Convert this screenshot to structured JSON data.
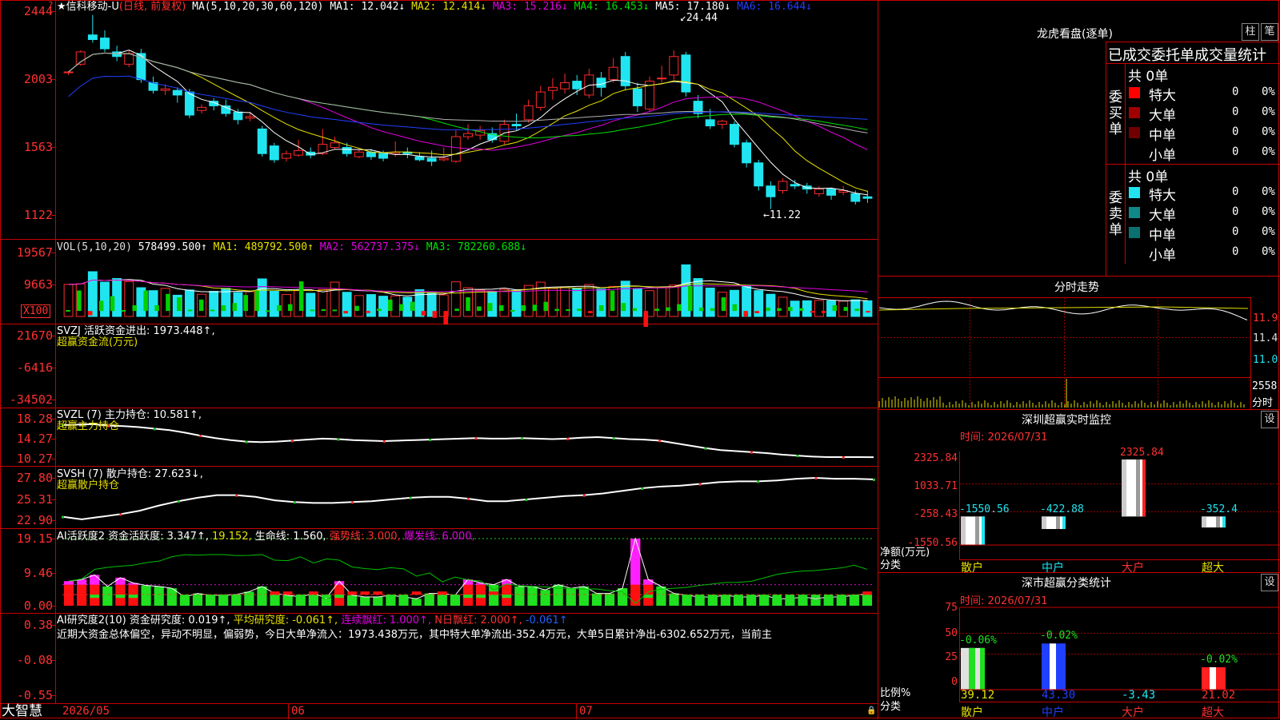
{
  "app": {
    "brand": "大智慧",
    "stock_title": "信科移动-U",
    "period": "(日线, 前复权)",
    "star": "★",
    "red_corner": "?"
  },
  "colors": {
    "up": "#ff2a2a",
    "down": "#20e5f0",
    "ma1": "#ffffff",
    "ma2": "#e6e000",
    "ma3": "#e000e0",
    "ma4": "#00e000",
    "ma5": "#b0b0b0",
    "ma6": "#2040ff",
    "bg": "#000000",
    "grid": "#c80000"
  },
  "header": {
    "ma_label": "MA(5,10,20,30,60,120)",
    "items": [
      {
        "text": "MA1: 12.042↓",
        "color": "#ffffff"
      },
      {
        "text": "MA2: 12.414↓",
        "color": "#e6e000"
      },
      {
        "text": "MA3: 15.216↓",
        "color": "#e000e0"
      },
      {
        "text": "MA4: 16.453↓",
        "color": "#00e000"
      },
      {
        "text": "MA5: 17.180↓",
        "color": "#ffffff"
      },
      {
        "text": "MA6: 16.644↓",
        "color": "#2040ff"
      }
    ]
  },
  "price_axis": [
    "2444",
    "2003",
    "1563",
    "1122"
  ],
  "price_annotations": {
    "high": "24.44",
    "low": "←11.22"
  },
  "vol_panel": {
    "header": "VOL(5,10,20)",
    "value": "578499.500↑",
    "ma1": "MA1: 489792.500↑",
    "ma2": "MA2: 562737.375↓",
    "ma3": "MA3: 782260.688↓",
    "axis": [
      "19567",
      "9663"
    ],
    "unit": "X100"
  },
  "svzj_panel": {
    "header": "SVZJ  活跃资金进出: 1973.448↑,",
    "subtitle": "超赢资金流(万元)",
    "axis": [
      "21670",
      "-6416",
      "-34502"
    ]
  },
  "svzl_panel": {
    "header": "SVZL (7) 主力持仓: 10.581↑,",
    "subtitle": "超赢主力持仓",
    "axis": [
      "18.28",
      "14.27",
      "10.27"
    ]
  },
  "svsh_panel": {
    "header": "SVSH (7) 散户持仓: 27.623↓,",
    "subtitle": "超赢散户持仓",
    "axis": [
      "27.80",
      "25.31",
      "22.90"
    ]
  },
  "ai_active_panel": {
    "header": "AI活跃度2 资金活跃度: 3.347↑,",
    "v2": "19.152,",
    "life": "生命线: 1.560,",
    "strong": "强势线: 3.000,",
    "burst": "爆发线: 6.000,",
    "axis": [
      "19.15",
      "9.46",
      "0.00"
    ]
  },
  "ai_research_panel": {
    "header": "AI研究度2(10) 资金研究度: 0.019↑,",
    "avg": "平均研究度: -0.061↑,",
    "cont": "连续飘红: 1.000↑,",
    "nday": "N日飘红: 2.000↑,",
    "last": "-0.061↑",
    "commentary": "近期大资金总体偏空，异动不明显，偏弱势，今日大单净流入：1973.438万元，其中特大单净流出-352.4万元，大单5日累计净出-6302.652万元，当前主",
    "axis": [
      "0.38",
      "-0.08",
      "-0.55"
    ]
  },
  "date_axis": [
    "2026/05",
    "06",
    "07"
  ],
  "lhb": {
    "title": "龙虎看盘(逐单)",
    "btn1": "柱",
    "btn2": "笔",
    "subtitle": "已成交委托单成交量统计",
    "buy": {
      "side": "委买单",
      "total": "共 0单",
      "rows": [
        {
          "label": "特大",
          "value": "0",
          "pct": "0%",
          "color": "#ff0000"
        },
        {
          "label": "大单",
          "value": "0",
          "pct": "0%",
          "color": "#a00000"
        },
        {
          "label": "中单",
          "value": "0",
          "pct": "0%",
          "color": "#700000"
        },
        {
          "label": "小单",
          "value": "0",
          "pct": "0%",
          "color": ""
        }
      ]
    },
    "sell": {
      "side": "委卖单",
      "total": "共 0单",
      "rows": [
        {
          "label": "特大",
          "value": "0",
          "pct": "0%",
          "color": "#20e5f0"
        },
        {
          "label": "大单",
          "value": "0",
          "pct": "0%",
          "color": "#108888"
        },
        {
          "label": "中单",
          "value": "0",
          "pct": "0%",
          "color": "#0a7070"
        },
        {
          "label": "小单",
          "value": "0",
          "pct": "0%",
          "color": ""
        }
      ]
    }
  },
  "intraday": {
    "title": "分时走势",
    "axis": [
      "11.9",
      "11.4",
      "11.0"
    ],
    "vol_axis": "2558",
    "vol_label": "分时"
  },
  "sz_monitor": {
    "title": "深圳超赢实时监控",
    "time": "时间: 2026/07/31",
    "settings": "设",
    "axis": [
      "2325.84",
      "1033.71",
      "-258.43",
      "-1550.56"
    ],
    "ylabel": "净额(万元)",
    "xlabel": "分类",
    "categories": [
      "散户",
      "中户",
      "大户",
      "超大"
    ],
    "labels": [
      "-1550.56",
      "-422.88",
      "2325.84",
      "-352.4"
    ]
  },
  "sz_class": {
    "title": "深市超赢分类统计",
    "time": "时间: 2026/07/31",
    "settings": "设",
    "axis": [
      "75",
      "50",
      "25",
      "0"
    ],
    "ylabel": "比例%",
    "xlabel": "分类",
    "categories": [
      "散户",
      "中户",
      "大户",
      "超大"
    ],
    "top_labels": [
      "-0.06%",
      "-0.02%",
      "",
      "-0.02%"
    ],
    "bottom_labels": [
      "39.12",
      "43.30",
      "-3.43",
      "21.02"
    ]
  },
  "chart_data": [
    {
      "type": "candlestick",
      "title": "信科移动-U",
      "ylim": [
        11.22,
        24.44
      ],
      "price_high": 24.44,
      "price_low": 11.22,
      "candles": [
        [
          20.5,
          20.5,
          20.5,
          20.3
        ],
        [
          21.0,
          21.8,
          21.9,
          20.9
        ],
        [
          22.9,
          22.6,
          24.2,
          22.4
        ],
        [
          22.7,
          22.0,
          23.2,
          21.8
        ],
        [
          21.8,
          21.5,
          22.2,
          21.2
        ],
        [
          21.0,
          21.7,
          21.9,
          20.8
        ],
        [
          21.7,
          20.0,
          22.0,
          19.8
        ],
        [
          19.8,
          19.3,
          20.2,
          19.1
        ],
        [
          19.3,
          19.4,
          19.7,
          19.0
        ],
        [
          19.3,
          19.0,
          19.5,
          18.5
        ],
        [
          19.2,
          17.7,
          19.4,
          17.5
        ],
        [
          18.0,
          18.2,
          18.4,
          17.8
        ],
        [
          18.6,
          18.3,
          18.8,
          18.0
        ],
        [
          18.3,
          17.8,
          18.7,
          17.6
        ],
        [
          17.9,
          17.4,
          18.1,
          17.1
        ],
        [
          17.5,
          17.6,
          17.9,
          17.3
        ],
        [
          16.8,
          15.2,
          17.0,
          15.0
        ],
        [
          15.7,
          14.8,
          15.9,
          14.6
        ],
        [
          14.9,
          15.2,
          15.4,
          14.7
        ],
        [
          15.1,
          15.4,
          16.1,
          15.0
        ],
        [
          15.3,
          15.1,
          15.6,
          14.9
        ],
        [
          15.2,
          15.8,
          16.8,
          15.1
        ],
        [
          15.6,
          15.9,
          16.3,
          15.5
        ],
        [
          15.6,
          15.2,
          15.9,
          15.0
        ],
        [
          15.0,
          15.3,
          15.5,
          14.9
        ],
        [
          15.3,
          15.0,
          15.5,
          14.8
        ],
        [
          15.2,
          14.9,
          15.4,
          14.7
        ],
        [
          15.2,
          15.3,
          16.0,
          15.0
        ],
        [
          15.3,
          15.2,
          15.6,
          14.9
        ],
        [
          15.0,
          14.8,
          15.3,
          14.7
        ],
        [
          14.9,
          14.7,
          15.4,
          14.4
        ],
        [
          14.8,
          14.9,
          15.6,
          14.7
        ],
        [
          14.7,
          16.3,
          16.7,
          14.6
        ],
        [
          16.3,
          16.5,
          17.1,
          16.1
        ],
        [
          16.4,
          16.7,
          17.0,
          16.1
        ],
        [
          16.5,
          16.1,
          16.9,
          15.9
        ],
        [
          16.0,
          17.1,
          17.4,
          15.8
        ],
        [
          17.1,
          17.0,
          17.8,
          16.7
        ],
        [
          17.4,
          18.3,
          18.7,
          17.2
        ],
        [
          18.2,
          19.2,
          19.6,
          18.0
        ],
        [
          19.3,
          19.5,
          20.1,
          18.7
        ],
        [
          19.4,
          19.8,
          20.4,
          19.1
        ],
        [
          19.9,
          19.4,
          20.3,
          19.0
        ],
        [
          19.0,
          20.3,
          20.7,
          18.8
        ],
        [
          20.1,
          19.5,
          20.5,
          18.9
        ],
        [
          20.0,
          20.8,
          21.4,
          19.8
        ],
        [
          21.5,
          19.6,
          21.8,
          19.3
        ],
        [
          19.4,
          18.3,
          19.8,
          17.9
        ],
        [
          18.1,
          19.9,
          20.2,
          17.9
        ],
        [
          20.1,
          20.1,
          20.9,
          19.8
        ],
        [
          20.3,
          21.5,
          21.9,
          20.0
        ],
        [
          21.6,
          19.2,
          21.8,
          18.9
        ],
        [
          18.6,
          17.8,
          19.0,
          17.5
        ],
        [
          17.4,
          17.0,
          18.1,
          16.8
        ],
        [
          17.1,
          17.3,
          17.4,
          16.8
        ],
        [
          17.1,
          15.8,
          17.3,
          15.6
        ],
        [
          15.9,
          14.6,
          16.1,
          14.3
        ],
        [
          14.6,
          13.1,
          14.8,
          12.8
        ],
        [
          13.1,
          12.4,
          13.4,
          11.6
        ],
        [
          12.8,
          13.4,
          13.6,
          12.6
        ],
        [
          13.2,
          13.1,
          13.5,
          12.9
        ],
        [
          13.1,
          12.9,
          13.3,
          12.6
        ],
        [
          12.6,
          12.9,
          13.1,
          12.4
        ],
        [
          12.9,
          12.5,
          13.0,
          12.2
        ],
        [
          12.7,
          12.8,
          13.1,
          12.5
        ],
        [
          12.6,
          12.1,
          12.8,
          11.9
        ],
        [
          12.4,
          12.3,
          12.8,
          12.0
        ]
      ]
    },
    {
      "type": "bar",
      "title": "VOL(5,10,20)",
      "ylim": [
        0,
        19567
      ],
      "values": [
        9800,
        10000,
        13700,
        10500,
        11600,
        10700,
        8800,
        7900,
        8600,
        6500,
        8100,
        6800,
        7700,
        8600,
        7300,
        7600,
        11500,
        7700,
        6700,
        7900,
        7100,
        8200,
        10500,
        7400,
        6400,
        6700,
        6200,
        6300,
        5900,
        8200,
        7300,
        6600,
        10600,
        8800,
        8100,
        7600,
        8300,
        8000,
        9500,
        10500,
        8600,
        8800,
        8600,
        9800,
        8400,
        9200,
        10800,
        8500,
        7900,
        8900,
        9600,
        15800,
        11600,
        8700,
        7400,
        8000,
        9400,
        7900,
        6800,
        5900,
        4700,
        4800,
        4900,
        4800,
        4700,
        5100,
        4800
      ]
    },
    {
      "type": "bar",
      "title": "超赢资金流(万元)",
      "ylim": [
        -34502,
        21670
      ],
      "values": [
        -800,
        -18000,
        3800,
        -9000,
        -13000,
        -800,
        -5000,
        -18000,
        -5000,
        -15000,
        -12000,
        -1200,
        -10000,
        -1200,
        -5000,
        -7000,
        -14000,
        -18000,
        -600,
        -5000,
        -6000,
        -26000,
        -1200,
        -1500,
        -1200,
        2200,
        -4500,
        1800,
        -2000,
        -10000,
        -6000,
        -8000,
        4000,
        6000,
        12000,
        -2000,
        -12000,
        -4000,
        -7000,
        -5000,
        -800,
        -5000,
        -5500,
        -8000,
        -1800,
        -1500,
        -2000,
        2000,
        -5000,
        -18000,
        -7000,
        -2500,
        14000,
        -2000,
        -3200,
        -6000,
        -22000,
        -3000,
        -2500,
        -12000,
        -6000,
        5000,
        2000,
        -3000,
        -2500,
        -3500,
        -2500,
        1500,
        1800,
        -5000,
        -3500,
        -2000,
        1300
      ]
    },
    {
      "type": "line",
      "title": "超赢主力持仓",
      "ylim": [
        10.27,
        18.28
      ],
      "values": [
        17.0,
        17.1,
        17.2,
        16.9,
        16.8,
        16.6,
        16.3,
        16.0,
        15.5,
        14.9,
        14.4,
        14.0,
        13.7,
        13.6,
        13.7,
        13.9,
        14.1,
        14.3,
        14.2,
        14.0,
        13.9,
        13.8,
        13.9,
        14.0,
        14.1,
        14.2,
        14.3,
        14.4,
        14.3,
        14.3,
        14.4,
        14.3,
        14.2,
        14.3,
        14.5,
        14.6,
        14.4,
        14.2,
        14.1,
        13.9,
        13.4,
        12.9,
        12.4,
        12.0,
        11.8,
        11.6,
        11.4,
        11.1,
        10.9,
        10.7,
        10.6,
        10.6,
        10.6,
        10.58
      ]
    },
    {
      "type": "line",
      "title": "超赢散户持仓",
      "ylim": [
        22.9,
        27.8
      ],
      "values": [
        23.3,
        23.0,
        23.3,
        23.6,
        24.0,
        24.6,
        25.1,
        25.5,
        25.8,
        25.8,
        25.6,
        25.2,
        25.0,
        24.9,
        24.9,
        25.0,
        25.1,
        25.3,
        25.5,
        25.6,
        25.6,
        25.4,
        25.1,
        25.1,
        25.3,
        25.5,
        25.7,
        25.8,
        26.0,
        26.3,
        26.6,
        26.8,
        26.9,
        27.1,
        27.3,
        27.4,
        27.4,
        27.5,
        27.7,
        27.8,
        27.7,
        27.7,
        27.623
      ]
    },
    {
      "type": "bar",
      "title": "AI活跃度2",
      "ylim": [
        0,
        19.15
      ],
      "reference_lines": {
        "strong": 3.0,
        "burst": 6.0,
        "top": 19.15
      },
      "values": [
        7.0,
        7.5,
        8.8,
        5.5,
        8.0,
        6.5,
        5.8,
        5.5,
        5.0,
        2.5,
        3.5,
        3.0,
        3.0,
        3.2,
        4.0,
        5.5,
        3.5,
        3.0,
        2.5,
        3.5,
        2.2,
        7.0,
        3.0,
        2.5,
        2.5,
        3.0,
        2.5,
        2.0,
        3.5,
        3.5,
        3.0,
        7.5,
        6.5,
        6.0,
        7.5,
        5.5,
        5.5,
        4.5,
        6.0,
        5.0,
        5.5,
        3.5,
        3.5,
        5.0,
        19.15,
        7.5,
        5.5,
        3.5,
        3.0,
        2.5,
        2.5,
        3.0,
        2.5,
        2.5,
        3.0,
        2.0,
        2.0,
        2.5,
        2.0,
        2.5,
        2.5,
        3.0,
        3.347
      ]
    },
    {
      "type": "bar",
      "title": "AI研究度2(10)",
      "ylim": [
        -0.55,
        0.38
      ],
      "values": [
        0.05,
        0.05,
        -0.05,
        -0.05,
        -0.04,
        -0.03,
        -0.04,
        -0.04,
        -0.08,
        -0.09,
        -0.07,
        -0.08,
        -0.09,
        -0.04,
        -0.04,
        -0.05,
        0.02,
        0.02,
        -0.04,
        0.03,
        -0.04,
        -0.04,
        0.03,
        0.03,
        0.02,
        -0.03,
        -0.04,
        0.03,
        -0.04,
        0.05,
        -0.04,
        -0.03,
        -0.04,
        0.05,
        -0.05,
        -0.05,
        -0.06,
        -0.07,
        -0.07,
        -0.08,
        -0.08,
        -0.09,
        -0.07,
        -0.06,
        0.1,
        -0.05,
        -0.08,
        -0.08,
        -0.08,
        -0.09,
        -0.09,
        -0.09,
        -0.07,
        -0.06,
        -0.08,
        -0.1,
        -0.1,
        -0.09,
        -0.07,
        -0.06,
        -0.05,
        -0.06,
        0.019
      ]
    },
    {
      "type": "bar",
      "title": "深圳超赢实时监控",
      "categories": [
        "散户",
        "中户",
        "大户",
        "超大"
      ],
      "values": [
        -1550.56,
        -422.88,
        2325.84,
        -352.4
      ],
      "ylim": [
        -1550.56,
        2325.84
      ],
      "ylabel": "净额(万元)",
      "xlabel": "分类"
    },
    {
      "type": "bar",
      "title": "深市超赢分类统计",
      "categories": [
        "散户",
        "中户",
        "大户",
        "超大"
      ],
      "values": [
        39.12,
        43.3,
        -3.43,
        21.02
      ],
      "ylim": [
        0,
        75
      ],
      "ylabel": "比例%",
      "xlabel": "分类"
    }
  ]
}
